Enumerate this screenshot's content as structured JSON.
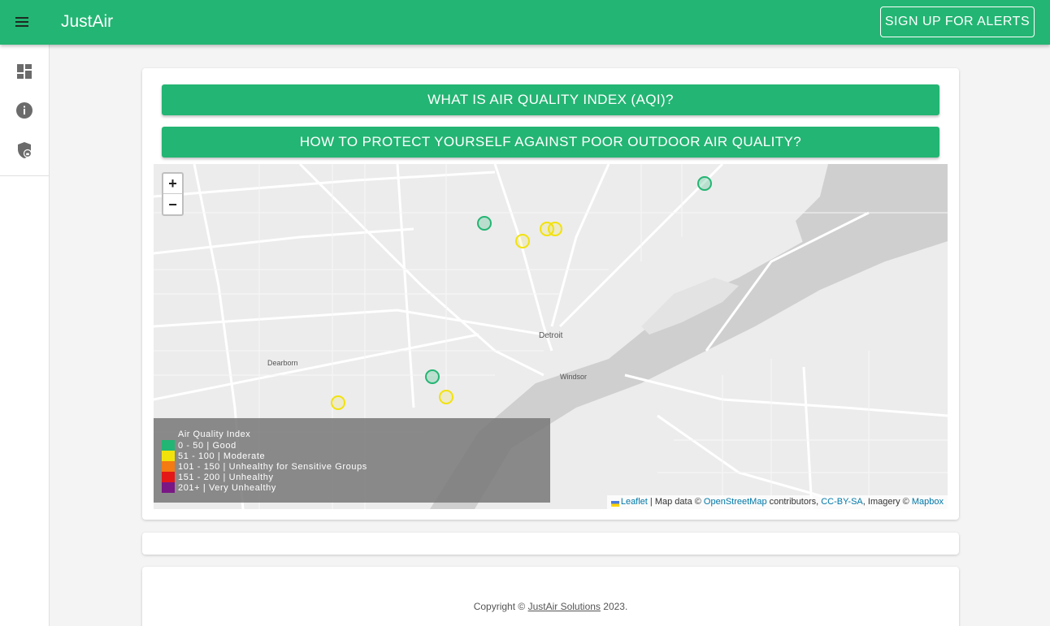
{
  "app": {
    "title": "JustAir",
    "signup_label": "SIGN UP FOR ALERTS"
  },
  "nav": {
    "icons": [
      "menu-icon",
      "dashboard-icon",
      "info-icon",
      "shield-lock-icon"
    ]
  },
  "main": {
    "buttons": [
      {
        "label": "WHAT IS AIR QUALITY INDEX (AQI)?"
      },
      {
        "label": "HOW TO PROTECT YOURSELF AGAINST POOR OUTDOOR AIR QUALITY?"
      }
    ],
    "map": {
      "zoom_in": "+",
      "zoom_out": "−",
      "labels": {
        "city": "Detroit",
        "windsor": "Windsor",
        "dearborn": "Dearborn"
      },
      "legend": {
        "title": "Air Quality Index",
        "items": [
          {
            "label": "0 - 50 | Good",
            "color": "#23b573"
          },
          {
            "label": "51 - 100 | Moderate",
            "color": "#f2e20c"
          },
          {
            "label": "101 - 150 | Unhealthy for Sensitive Groups",
            "color": "#f47a12"
          },
          {
            "label": "151 - 200 | Unhealthy",
            "color": "#e51818"
          },
          {
            "label": "201+ | Very Unhealthy",
            "color": "#7a1785"
          }
        ]
      },
      "attribution": {
        "leaflet": "Leaflet",
        "map_data": " | Map data © ",
        "osm": "OpenStreetMap",
        "contributors": " contributors, ",
        "license": "CC-BY-SA",
        "imagery": ", Imagery © ",
        "mapbox": "Mapbox"
      }
    }
  },
  "footer": {
    "prefix": "Copyright © ",
    "company": "JustAir Solutions",
    "suffix": " 2023."
  },
  "colors": {
    "brand": "#23b573",
    "good": "#23b573",
    "moderate": "#f2e20c"
  }
}
